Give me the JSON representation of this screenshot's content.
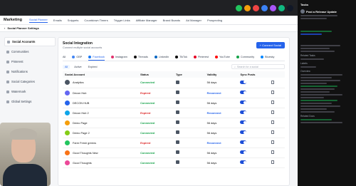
{
  "topbar": {
    "dots": [
      "#22c55e",
      "#f59e0b",
      "#ef4444",
      "#3b82f6",
      "#a855f7",
      "#10b981",
      "#111827"
    ]
  },
  "nav": {
    "brand": "Marketing",
    "items": [
      "Social Planner",
      "Emails",
      "Snippets",
      "Countdown Timers",
      "Trigger Links",
      "Affiliate Manager",
      "Brand Boards",
      "Ad Manager",
      "Prospecting"
    ],
    "active": "Social Planner"
  },
  "subnav": {
    "title": "Social Planner Settings"
  },
  "sidebar": {
    "items": [
      "Social Accounts",
      "Communities",
      "Pinterest",
      "Notifications",
      "Social Categories",
      "Watermark",
      "Global Settings"
    ]
  },
  "panel": {
    "title": "Social Integration",
    "subtitle": "Connect multiple social accounts",
    "connect_label": "+ Connect Social",
    "platforms": [
      {
        "label": "All",
        "color": "#6b7280"
      },
      {
        "label": "GBP",
        "color": "#4285f4"
      },
      {
        "label": "Facebook",
        "color": "#1877f2"
      },
      {
        "label": "Instagram",
        "color": "#e1306c"
      },
      {
        "label": "Threads",
        "color": "#111111"
      },
      {
        "label": "LinkedIn",
        "color": "#0a66c2"
      },
      {
        "label": "TikTok",
        "color": "#000000"
      },
      {
        "label": "Pinterest",
        "color": "#e60023"
      },
      {
        "label": "YouTube",
        "color": "#ff0000"
      },
      {
        "label": "Community",
        "color": "#16a34a"
      },
      {
        "label": "Bluesky",
        "color": "#0085ff"
      }
    ],
    "filters": [
      "All",
      "Active",
      "Expired"
    ],
    "search_placeholder": "Search for a social",
    "columns": [
      "Social Account",
      "Status",
      "Type",
      "Validity",
      "Sync Posts"
    ],
    "rows": [
      {
        "name": "Analytics",
        "status": "Connected",
        "validity": "56 days"
      },
      {
        "name": "Decon Hub",
        "status": "Expired",
        "validity": "Reconnect"
      },
      {
        "name": "DECON HUB",
        "status": "Connected",
        "validity": "56 days"
      },
      {
        "name": "Decon Hub 2",
        "status": "Expired",
        "validity": "Reconnect"
      },
      {
        "name": "Demo Page",
        "status": "Connected",
        "validity": "56 days"
      },
      {
        "name": "Demo Page 2",
        "status": "Connected",
        "validity": "56 days"
      },
      {
        "name": "Farm Fresh greens",
        "status": "Expired",
        "validity": "Reconnect"
      },
      {
        "name": "Good Thoughts New",
        "status": "Connected",
        "validity": "56 days"
      },
      {
        "name": "Good Thoughts",
        "status": "Connected",
        "validity": "56 days"
      }
    ]
  },
  "right_panel": {
    "title": "Tasks",
    "heading": "Post a Release Update",
    "labels": [
      "Related Tasks",
      "Labels",
      "Overview",
      "Related Docs"
    ]
  }
}
